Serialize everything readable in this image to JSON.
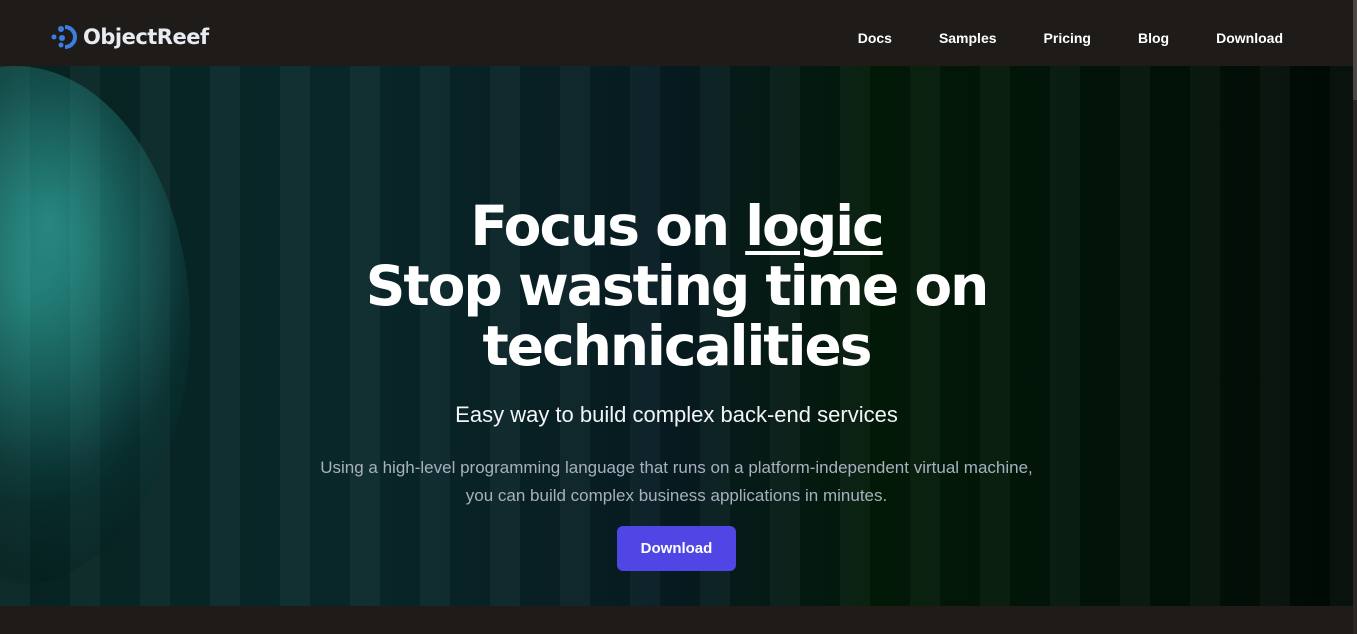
{
  "brand": {
    "name": "ObjectReef",
    "accent": "#3b7ee0"
  },
  "nav": {
    "items": [
      "Docs",
      "Samples",
      "Pricing",
      "Blog",
      "Download"
    ]
  },
  "hero": {
    "line1_prefix": "Focus on ",
    "line1_emph": "logic",
    "line2": "Stop wasting time on technicalities",
    "subtitle": "Easy way to build complex back-end services",
    "desc_line1": "Using a high-level programming language that runs on a platform-independent virtual machine,",
    "desc_line2": "you can build complex business applications in minutes.",
    "cta": "Download",
    "cta_color": "#4f46e5"
  }
}
